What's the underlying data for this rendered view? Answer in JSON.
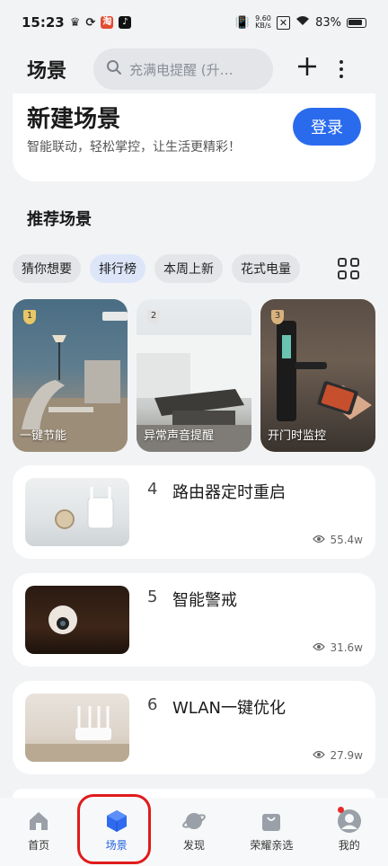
{
  "status": {
    "time": "15:23",
    "net_speed_value": "9.60",
    "net_speed_unit": "KB/s",
    "battery": "83%"
  },
  "header": {
    "title": "场景",
    "search_placeholder": "充满电提醒 (升…"
  },
  "new_scene": {
    "title": "新建场景",
    "subtitle": "智能联动，轻松掌控，让生活更精彩！",
    "login_label": "登录"
  },
  "recommend": {
    "title": "推荐场景",
    "chips": [
      "猜你想要",
      "排行榜",
      "本周上新",
      "花式电量"
    ],
    "active_chip": "排行榜"
  },
  "top_cards": [
    {
      "rank": "1",
      "label": "一键节能"
    },
    {
      "rank": "2",
      "label": "异常声音提醒"
    },
    {
      "rank": "3",
      "label": "开门时监控"
    }
  ],
  "list": [
    {
      "rank": "4",
      "title": "路由器定时重启",
      "views": "55.4w"
    },
    {
      "rank": "5",
      "title": "智能警戒",
      "views": "31.6w"
    },
    {
      "rank": "6",
      "title": "WLAN一键优化",
      "views": "27.9w"
    }
  ],
  "nav": [
    {
      "label": "首页",
      "icon": "home-icon"
    },
    {
      "label": "场景",
      "icon": "scene-cube-icon"
    },
    {
      "label": "发现",
      "icon": "planet-icon"
    },
    {
      "label": "荣耀亲选",
      "icon": "shopping-bag-icon"
    },
    {
      "label": "我的",
      "icon": "profile-icon"
    }
  ],
  "colors": {
    "accent": "#2a6bee",
    "highlight": "#e01b1b"
  }
}
